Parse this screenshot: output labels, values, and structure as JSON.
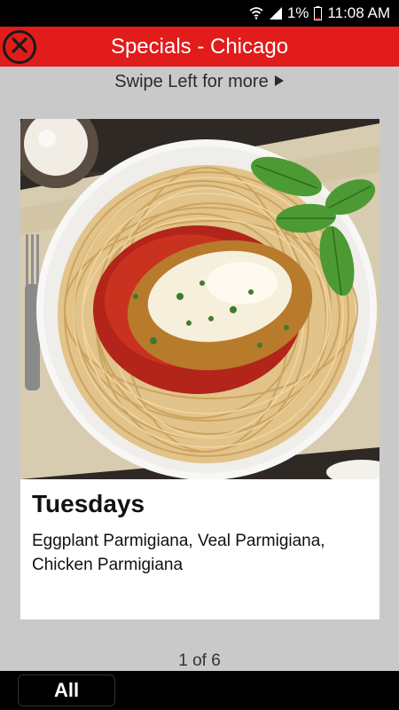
{
  "status_bar": {
    "battery": "1%",
    "time": "11:08 AM",
    "icons": [
      "wifi-icon",
      "signal-icon",
      "battery-icon"
    ]
  },
  "header": {
    "title": "Specials - Chicago",
    "close_icon": "close-icon",
    "background": "#e21b1b"
  },
  "swipe_hint": {
    "text": "Swipe Left for more",
    "icon": "play-arrow-icon"
  },
  "special": {
    "image": "chicken-parmigiana-spaghetti",
    "title": "Tuesdays",
    "description": "Eggplant Parmigiana, Veal Parmigiana, Chicken Parmigiana"
  },
  "pager": {
    "text": "1 of 6"
  },
  "bottom_bar": {
    "all_label": "All"
  }
}
